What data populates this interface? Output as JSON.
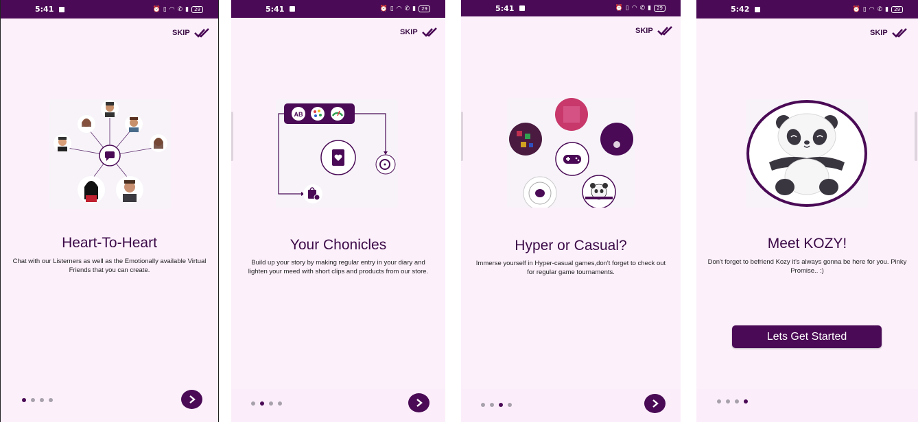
{
  "screens": [
    {
      "status_time": "5:41",
      "battery": "29",
      "skip_label": "SKIP",
      "title": "Heart-To-Heart",
      "description": "Chat with our Listerners as well as the Emotionally available Virtual Friends that you can create.",
      "active_page": 1
    },
    {
      "status_time": "5:41",
      "battery": "29",
      "skip_label": "SKIP",
      "title": "Your Chonicles",
      "description": "Build up your story by making regular entry in your diary and lighten your meed with short clips and products from our store.",
      "active_page": 2,
      "illustration_badge": "AB"
    },
    {
      "status_time": "5:41",
      "battery": "29",
      "skip_label": "SKIP",
      "title": "Hyper or Casual?",
      "description": "Immerse yourself in Hyper-casual games,don't forget to check out for regular game tournaments.",
      "active_page": 3
    },
    {
      "status_time": "5:42",
      "battery": "29",
      "skip_label": "SKIP",
      "title": "Meet KOZY!",
      "description": "Don't forget to befriend Kozy it's always gonna be here for you. Pinky Promise.. :)",
      "active_page": 4,
      "cta_label": "Lets Get Started"
    }
  ],
  "page_count": 4,
  "icons": {
    "skip": "double-check-icon",
    "next": "chevron-right-icon",
    "status": [
      "alarm-icon",
      "vibrate-icon",
      "wifi-icon",
      "wifi-calling-icon",
      "signal-icon",
      "battery-icon"
    ]
  },
  "colors": {
    "primary": "#4a0a55",
    "background": "#fcf0fb",
    "title": "#3b0a47",
    "dot_inactive": "#a7a1ab"
  }
}
